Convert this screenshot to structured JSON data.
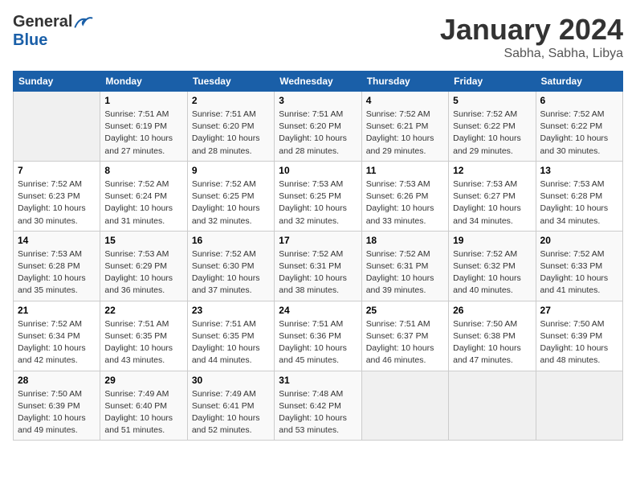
{
  "logo": {
    "general": "General",
    "blue": "Blue"
  },
  "title": "January 2024",
  "location": "Sabha, Sabha, Libya",
  "days_of_week": [
    "Sunday",
    "Monday",
    "Tuesday",
    "Wednesday",
    "Thursday",
    "Friday",
    "Saturday"
  ],
  "weeks": [
    [
      {
        "day": "",
        "info": ""
      },
      {
        "day": "1",
        "info": "Sunrise: 7:51 AM\nSunset: 6:19 PM\nDaylight: 10 hours\nand 27 minutes."
      },
      {
        "day": "2",
        "info": "Sunrise: 7:51 AM\nSunset: 6:20 PM\nDaylight: 10 hours\nand 28 minutes."
      },
      {
        "day": "3",
        "info": "Sunrise: 7:51 AM\nSunset: 6:20 PM\nDaylight: 10 hours\nand 28 minutes."
      },
      {
        "day": "4",
        "info": "Sunrise: 7:52 AM\nSunset: 6:21 PM\nDaylight: 10 hours\nand 29 minutes."
      },
      {
        "day": "5",
        "info": "Sunrise: 7:52 AM\nSunset: 6:22 PM\nDaylight: 10 hours\nand 29 minutes."
      },
      {
        "day": "6",
        "info": "Sunrise: 7:52 AM\nSunset: 6:22 PM\nDaylight: 10 hours\nand 30 minutes."
      }
    ],
    [
      {
        "day": "7",
        "info": "Sunrise: 7:52 AM\nSunset: 6:23 PM\nDaylight: 10 hours\nand 30 minutes."
      },
      {
        "day": "8",
        "info": "Sunrise: 7:52 AM\nSunset: 6:24 PM\nDaylight: 10 hours\nand 31 minutes."
      },
      {
        "day": "9",
        "info": "Sunrise: 7:52 AM\nSunset: 6:25 PM\nDaylight: 10 hours\nand 32 minutes."
      },
      {
        "day": "10",
        "info": "Sunrise: 7:53 AM\nSunset: 6:25 PM\nDaylight: 10 hours\nand 32 minutes."
      },
      {
        "day": "11",
        "info": "Sunrise: 7:53 AM\nSunset: 6:26 PM\nDaylight: 10 hours\nand 33 minutes."
      },
      {
        "day": "12",
        "info": "Sunrise: 7:53 AM\nSunset: 6:27 PM\nDaylight: 10 hours\nand 34 minutes."
      },
      {
        "day": "13",
        "info": "Sunrise: 7:53 AM\nSunset: 6:28 PM\nDaylight: 10 hours\nand 34 minutes."
      }
    ],
    [
      {
        "day": "14",
        "info": "Sunrise: 7:53 AM\nSunset: 6:28 PM\nDaylight: 10 hours\nand 35 minutes."
      },
      {
        "day": "15",
        "info": "Sunrise: 7:53 AM\nSunset: 6:29 PM\nDaylight: 10 hours\nand 36 minutes."
      },
      {
        "day": "16",
        "info": "Sunrise: 7:52 AM\nSunset: 6:30 PM\nDaylight: 10 hours\nand 37 minutes."
      },
      {
        "day": "17",
        "info": "Sunrise: 7:52 AM\nSunset: 6:31 PM\nDaylight: 10 hours\nand 38 minutes."
      },
      {
        "day": "18",
        "info": "Sunrise: 7:52 AM\nSunset: 6:31 PM\nDaylight: 10 hours\nand 39 minutes."
      },
      {
        "day": "19",
        "info": "Sunrise: 7:52 AM\nSunset: 6:32 PM\nDaylight: 10 hours\nand 40 minutes."
      },
      {
        "day": "20",
        "info": "Sunrise: 7:52 AM\nSunset: 6:33 PM\nDaylight: 10 hours\nand 41 minutes."
      }
    ],
    [
      {
        "day": "21",
        "info": "Sunrise: 7:52 AM\nSunset: 6:34 PM\nDaylight: 10 hours\nand 42 minutes."
      },
      {
        "day": "22",
        "info": "Sunrise: 7:51 AM\nSunset: 6:35 PM\nDaylight: 10 hours\nand 43 minutes."
      },
      {
        "day": "23",
        "info": "Sunrise: 7:51 AM\nSunset: 6:35 PM\nDaylight: 10 hours\nand 44 minutes."
      },
      {
        "day": "24",
        "info": "Sunrise: 7:51 AM\nSunset: 6:36 PM\nDaylight: 10 hours\nand 45 minutes."
      },
      {
        "day": "25",
        "info": "Sunrise: 7:51 AM\nSunset: 6:37 PM\nDaylight: 10 hours\nand 46 minutes."
      },
      {
        "day": "26",
        "info": "Sunrise: 7:50 AM\nSunset: 6:38 PM\nDaylight: 10 hours\nand 47 minutes."
      },
      {
        "day": "27",
        "info": "Sunrise: 7:50 AM\nSunset: 6:39 PM\nDaylight: 10 hours\nand 48 minutes."
      }
    ],
    [
      {
        "day": "28",
        "info": "Sunrise: 7:50 AM\nSunset: 6:39 PM\nDaylight: 10 hours\nand 49 minutes."
      },
      {
        "day": "29",
        "info": "Sunrise: 7:49 AM\nSunset: 6:40 PM\nDaylight: 10 hours\nand 51 minutes."
      },
      {
        "day": "30",
        "info": "Sunrise: 7:49 AM\nSunset: 6:41 PM\nDaylight: 10 hours\nand 52 minutes."
      },
      {
        "day": "31",
        "info": "Sunrise: 7:48 AM\nSunset: 6:42 PM\nDaylight: 10 hours\nand 53 minutes."
      },
      {
        "day": "",
        "info": ""
      },
      {
        "day": "",
        "info": ""
      },
      {
        "day": "",
        "info": ""
      }
    ]
  ]
}
